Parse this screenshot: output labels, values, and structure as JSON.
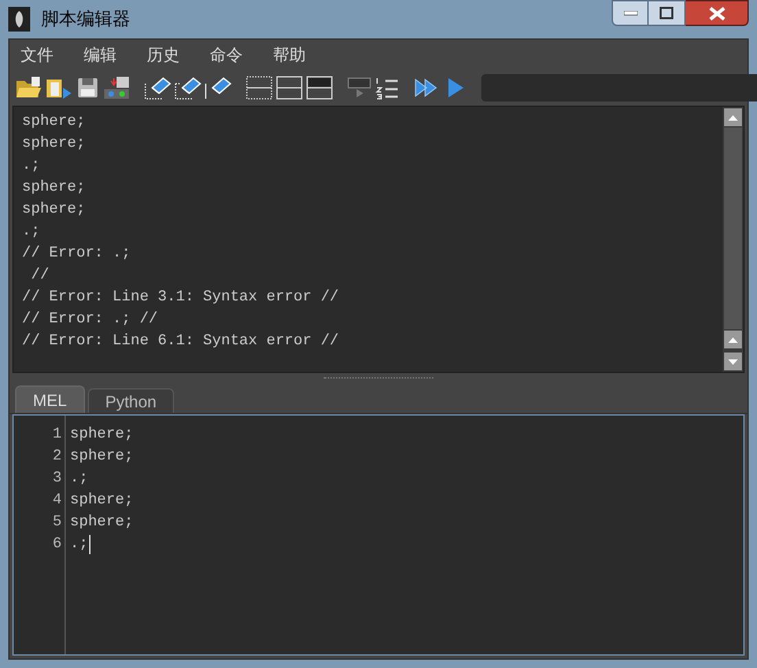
{
  "window": {
    "title": "脚本编辑器"
  },
  "menu": [
    "文件",
    "编辑",
    "历史",
    "命令",
    "帮助"
  ],
  "output_lines": [
    "sphere;",
    "sphere;",
    ".;",
    "sphere;",
    "sphere;",
    ".;",
    "// Error: .;",
    " //",
    "// Error: Line 3.1: Syntax error //",
    "// Error: .; //",
    "// Error: Line 6.1: Syntax error //"
  ],
  "tabs": [
    {
      "label": "MEL",
      "selected": true
    },
    {
      "label": "Python",
      "selected": false
    }
  ],
  "editor": {
    "lines": [
      {
        "number": "1",
        "text": "sphere;"
      },
      {
        "number": "2",
        "text": "sphere;"
      },
      {
        "number": "3",
        "text": ".;"
      },
      {
        "number": "4",
        "text": "sphere;"
      },
      {
        "number": "5",
        "text": "sphere;"
      },
      {
        "number": "6",
        "text": ".;"
      }
    ]
  }
}
